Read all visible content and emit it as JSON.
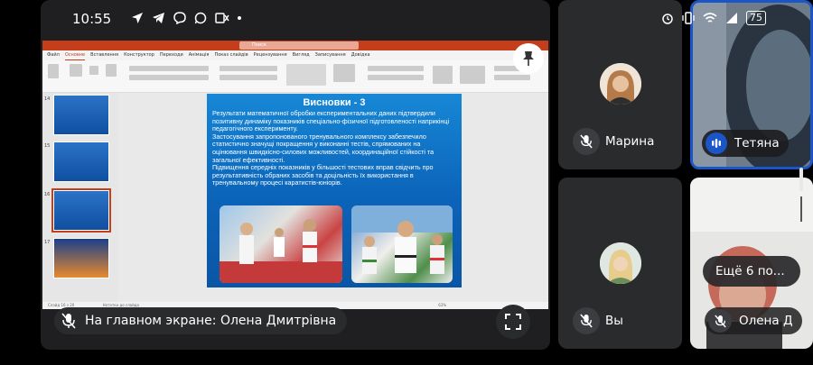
{
  "status_bar": {
    "time": "10:55",
    "battery": "75",
    "icons": [
      "location-arrow-icon",
      "telegram-icon",
      "viber-icon",
      "whatsapp-icon",
      "sim-card-icon",
      "dot-icon"
    ],
    "right_icons": [
      "alarm-icon",
      "vibrate-icon",
      "wifi-icon",
      "signal-icon",
      "battery-icon"
    ]
  },
  "shared_screen": {
    "presenter_label": "На главном экране: Олена Дмитрівна",
    "app": {
      "title_search": "Поиск",
      "tabs": [
        "Файл",
        "Основне",
        "Вставлення",
        "Конструктор",
        "Переходи",
        "Анімація",
        "Показ слайдів",
        "Рецензування",
        "Вигляд",
        "Записування",
        "Довідка"
      ],
      "active_tab": "Основне",
      "thumbnail_numbers": [
        "14",
        "15",
        "16",
        "17"
      ],
      "notes_placeholder": "Нотатки до слайда",
      "status_text": "Слайд 16 з 20",
      "zoom": "63%"
    },
    "slide": {
      "title": "Висновки - 3",
      "body": "   Результати математичної обробки експериментальних даних підтвердили позитивну динаміку показників спеціально-фізичної підготовленості наприкінці педагогічного експерименту.\n   Застосування запропонованого тренувального комплексу забезпечило статистично значущі покращення у виконанні тестів, спрямованих на оцінювання швидкісно-силових можливостей, координаційної стійкості та загальної ефективності.\n   Підвищення середніх показників у більшості тестових вправ свідчить про результативність обраних засобів та доцільність їх використання в тренувальному процесі каратистів-юніорів."
    }
  },
  "participants": [
    {
      "name": "Марина",
      "muted": true
    },
    {
      "name": "Тетяна",
      "muted": false,
      "speaking": true
    },
    {
      "name": "Вы",
      "muted": true
    },
    {
      "name": "Олена Д",
      "muted": true
    }
  ],
  "more_participants": "Ещё 6 по...",
  "colors": {
    "accent_blue": "#1a56c7",
    "tile_bg": "#2a2b2d",
    "powerpoint_red": "#c43e1c"
  }
}
